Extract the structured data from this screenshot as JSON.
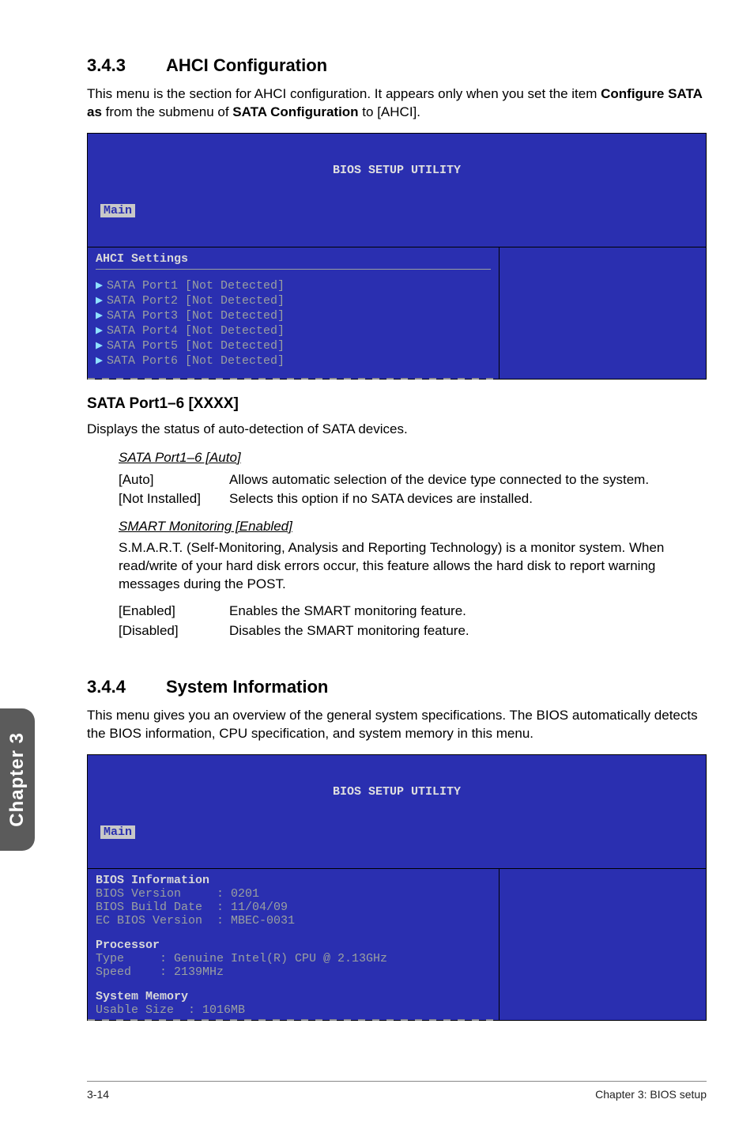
{
  "section343": {
    "number": "3.4.3",
    "title": "AHCI Configuration",
    "intro_pre": "This menu is the section for AHCI configuration. It appears only when you set the item ",
    "intro_bold1": "Configure SATA as",
    "intro_mid": " from the submenu of ",
    "intro_bold2": "SATA Configuration",
    "intro_post": " to [AHCI]."
  },
  "bios1": {
    "title": "BIOS SETUP UTILITY",
    "tab": "Main",
    "heading": "AHCI Settings",
    "lines": [
      "SATA Port1 [Not Detected]",
      "SATA Port2 [Not Detected]",
      "SATA Port3 [Not Detected]",
      "SATA Port4 [Not Detected]",
      "SATA Port5 [Not Detected]",
      "SATA Port6 [Not Detected]"
    ]
  },
  "sata": {
    "heading": "SATA Port1–6 [XXXX]",
    "desc": "Displays the status of auto-detection of SATA devices.",
    "sub1_title": "SATA Port1–6 [Auto]",
    "auto_k": "[Auto]",
    "auto_v": "Allows automatic selection of the device type connected to the system.",
    "ni_k": "[Not Installed]",
    "ni_v": "Selects this option if no SATA devices are installed.",
    "sub2_title": "SMART Monitoring [Enabled]",
    "smart_para": "S.M.A.R.T. (Self-Monitoring, Analysis and Reporting Technology) is a monitor system. When read/write of your hard disk errors occur, this feature allows the hard disk to report warning messages during the POST.",
    "en_k": "[Enabled]",
    "en_v": "Enables the SMART monitoring feature.",
    "dis_k": "[Disabled]",
    "dis_v": "Disables the SMART monitoring feature."
  },
  "section344": {
    "number": "3.4.4",
    "title": "System Information",
    "intro": "This menu gives you an overview of the general system specifications. The BIOS automatically detects the BIOS information, CPU specification, and system memory in this menu."
  },
  "bios2": {
    "title": "BIOS SETUP UTILITY",
    "tab": "Main",
    "h_bios": "BIOS Information",
    "l_biosver": "BIOS Version     : 0201",
    "l_biosbld": "BIOS Build Date  : 11/04/09",
    "l_ecver": "EC BIOS Version  : MBEC-0031",
    "h_proc": "Processor",
    "l_type": "Type     : Genuine Intel(R) CPU @ 2.13GHz",
    "l_speed": "Speed    : 2139MHz",
    "h_mem": "System Memory",
    "l_usable": "Usable Size  : 1016MB"
  },
  "sidetab": "Chapter 3",
  "footer": {
    "left": "3-14",
    "right": "Chapter 3: BIOS setup"
  },
  "chart_data": null
}
